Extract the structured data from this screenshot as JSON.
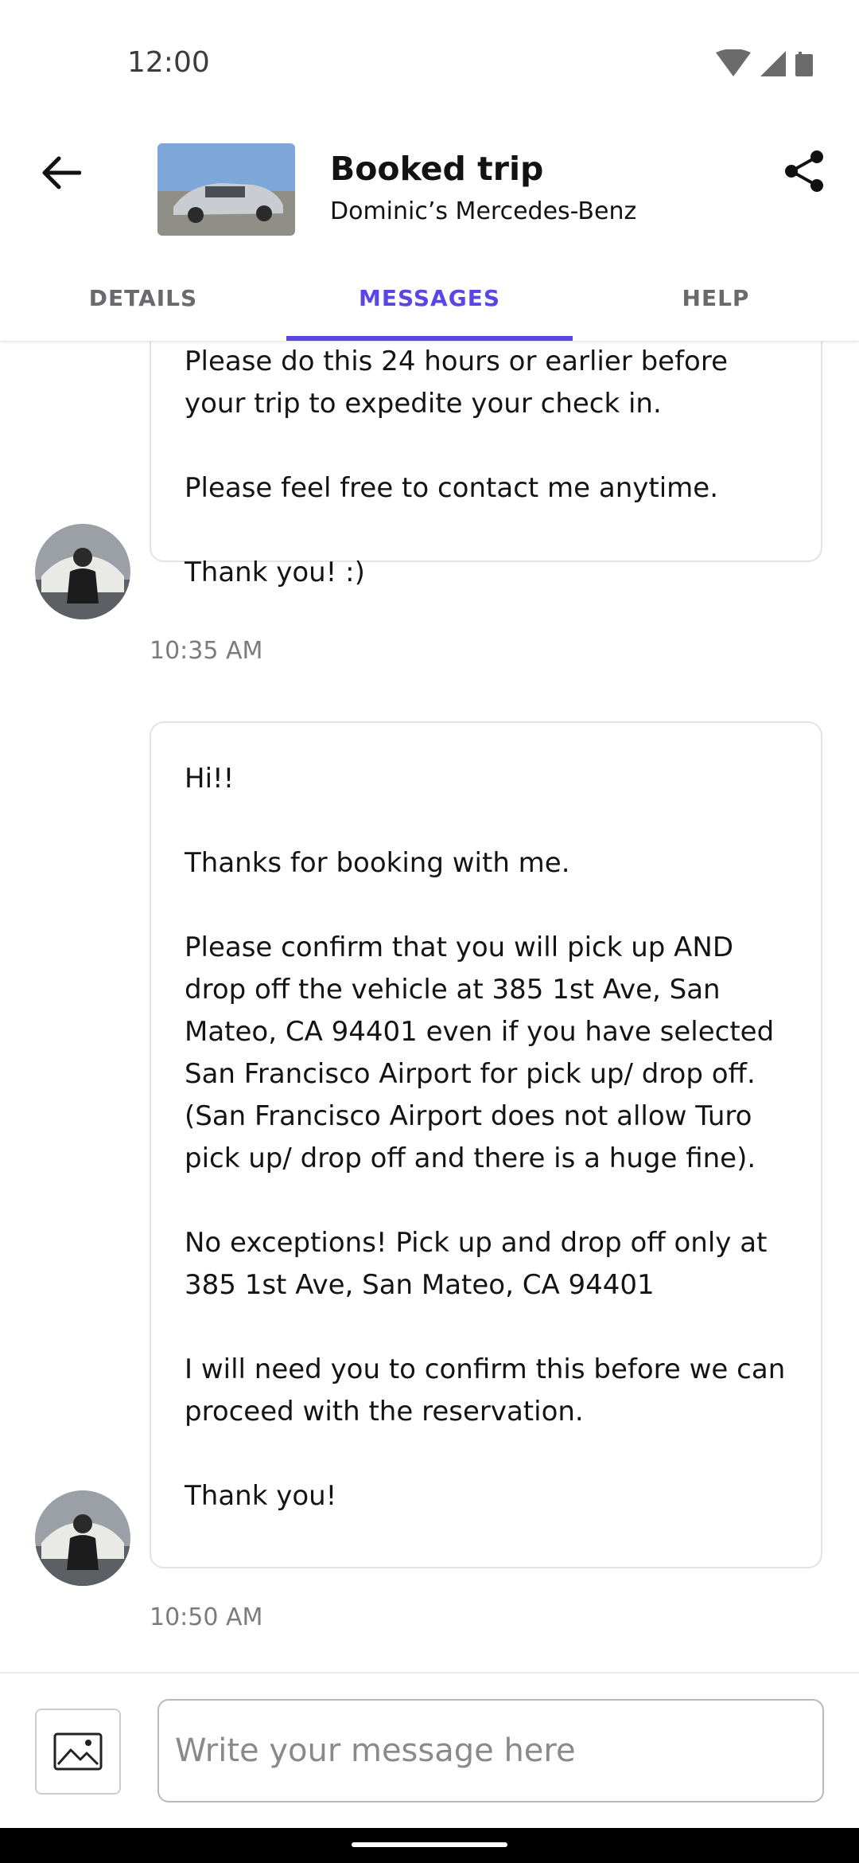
{
  "status_bar": {
    "time": "12:00",
    "icons": [
      "wifi-icon",
      "signal-icon",
      "battery-icon"
    ]
  },
  "header": {
    "back_icon": "arrow-left-icon",
    "title": "Booked trip",
    "subtitle": "Dominic’s Mercedes-Benz",
    "share_icon": "share-icon"
  },
  "tabs": [
    {
      "label": "DETAILS",
      "active": false
    },
    {
      "label": "MESSAGES",
      "active": true
    },
    {
      "label": "HELP",
      "active": false
    }
  ],
  "messages": [
    {
      "text": "Please do this 24 hours or earlier before your trip to expedite your check in.\n\nPlease feel free to contact me anytime.\n\nThank you! :)",
      "time": "10:35 AM"
    },
    {
      "text": "Hi!!\n\nThanks for booking with me.\n\nPlease confirm that you will pick up AND drop off the vehicle at 385 1st Ave, San Mateo, CA 94401 even if you have selected San Francisco Airport for pick up/ drop off. (San Francisco Airport does not allow Turo pick up/ drop off and there is a huge fine).\n\nNo exceptions! Pick up and drop off only at 385 1st Ave, San Mateo, CA 94401\n\nI will need you to confirm this before we can proceed with the reservation.\n\nThank you!",
      "time": "10:50 AM"
    }
  ],
  "composer": {
    "attach_icon": "image-icon",
    "placeholder": "Write your message here",
    "value": ""
  },
  "colors": {
    "accent": "#5a46e6",
    "border": "#e3e3e6",
    "muted_text": "#7c7c80"
  }
}
